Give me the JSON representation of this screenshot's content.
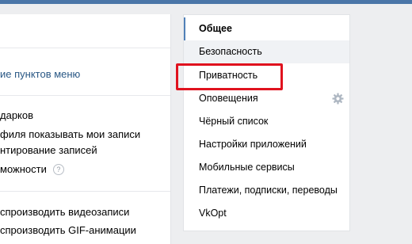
{
  "left_panel": {
    "menu_items_link": "ие пунктов меню",
    "options": [
      "дарков",
      "филя показывать мои записи",
      "нтирование записей",
      "можности"
    ],
    "help_icon_glyph": "?",
    "autoplay_options": [
      "спроизводить видеозаписи",
      "спроизводить GIF-анимации"
    ]
  },
  "settings_menu": {
    "items": [
      {
        "label": "Общее",
        "state": "active"
      },
      {
        "label": "Безопасность",
        "state": "hover"
      },
      {
        "label": "Приватность",
        "state": "highlighted"
      },
      {
        "label": "Оповещения",
        "state": "normal",
        "icon": "gear-icon"
      },
      {
        "label": "Чёрный список",
        "state": "normal"
      },
      {
        "label": "Настройки приложений",
        "state": "normal"
      },
      {
        "label": "Мобильные сервисы",
        "state": "normal"
      },
      {
        "label": "Платежи, подписки, переводы",
        "state": "normal"
      },
      {
        "label": "VkOpt",
        "state": "normal"
      }
    ]
  },
  "colors": {
    "accent": "#5181b8",
    "link": "#2a5885",
    "highlight_border": "#e0121e",
    "background": "#edeef0"
  }
}
